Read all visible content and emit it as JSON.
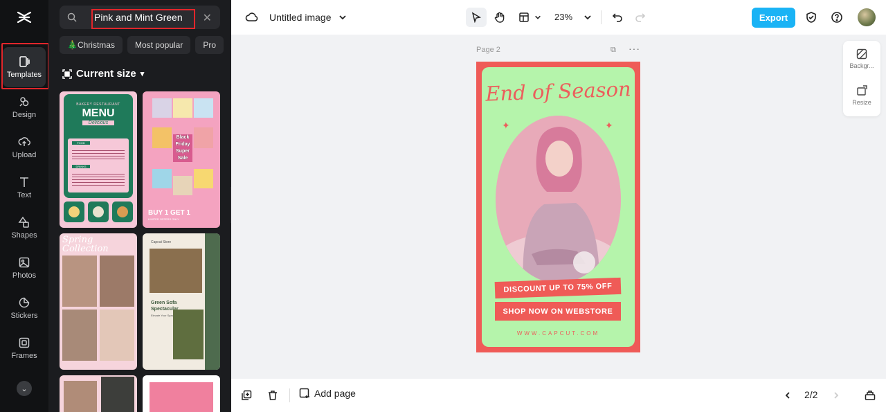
{
  "sidebar": {
    "items": [
      {
        "label": "Templates",
        "icon": "templates-icon"
      },
      {
        "label": "Design",
        "icon": "design-icon"
      },
      {
        "label": "Upload",
        "icon": "upload-icon"
      },
      {
        "label": "Text",
        "icon": "text-icon"
      },
      {
        "label": "Shapes",
        "icon": "shapes-icon"
      },
      {
        "label": "Photos",
        "icon": "photos-icon"
      },
      {
        "label": "Stickers",
        "icon": "stickers-icon"
      },
      {
        "label": "Frames",
        "icon": "frames-icon"
      }
    ],
    "active": "Templates"
  },
  "panel": {
    "search_value": "Pink and Mint Green",
    "chips": [
      "🎄Christmas",
      "Most popular",
      "Pro"
    ],
    "current_size_label": "Current size",
    "templates": {
      "menu": {
        "brand": "BAKERY RESTAURANT",
        "title": "MENU",
        "subtitle": "Delicious",
        "sections": [
          "FOOD",
          "DRINKS"
        ]
      },
      "black_friday": {
        "title_lines": [
          "Black",
          "Friday",
          "Super",
          "Sale"
        ],
        "offer": "BUY 1 GET 1",
        "offer_sub": "LIMITED OFFERS ONLY"
      },
      "spring": {
        "title": "Spring Collection"
      },
      "sofa": {
        "brand": "Capcut Store",
        "title": "Green Sofa Spectacular",
        "subtitle": "Elevate Your Space"
      }
    }
  },
  "topbar": {
    "doc_title": "Untitled image",
    "zoom": "23%",
    "export_label": "Export"
  },
  "canvas": {
    "page_label": "Page 2",
    "design": {
      "headline": "End of Season",
      "banner1": "DISCOUNT UP TO 75% OFF",
      "banner2": "SHOP NOW ON WEBSTORE",
      "url": "WWW.CAPCUT.COM"
    },
    "right_panel": [
      {
        "label": "Backgr...",
        "icon": "background-icon"
      },
      {
        "label": "Resize",
        "icon": "resize-icon"
      }
    ]
  },
  "bottombar": {
    "add_page_label": "Add page",
    "page_indicator": "2/2"
  },
  "colors": {
    "accent": "#1ab3f5",
    "highlight": "#e2262b",
    "design_red": "#ef5b57",
    "design_mint": "#b5f4ab",
    "sidebar_bg": "#111214",
    "panel_bg": "#1b1c1f"
  }
}
